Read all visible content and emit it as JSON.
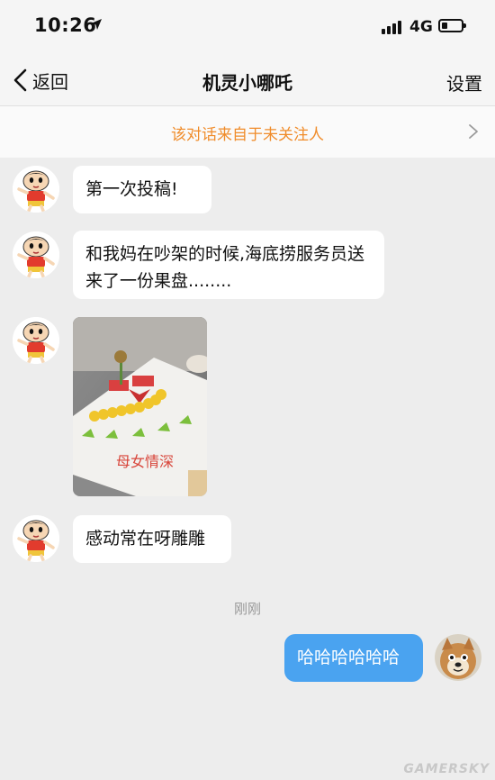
{
  "status_bar": {
    "time": "10:26",
    "network": "4G"
  },
  "nav": {
    "back_label": "返回",
    "title": "机灵小哪吒",
    "settings_label": "设置"
  },
  "notice": {
    "text": "该对话来自于未关注人"
  },
  "messages": [
    {
      "direction": "incoming",
      "type": "text",
      "text": "第一次投稿!"
    },
    {
      "direction": "incoming",
      "type": "text",
      "text": "和我妈在吵架的时候,海底捞服务员送来了一份果盘........"
    },
    {
      "direction": "incoming",
      "type": "image",
      "caption": "母女情深"
    },
    {
      "direction": "incoming",
      "type": "text",
      "text": "感动常在呀雕雕"
    },
    {
      "direction": "outgoing",
      "type": "text",
      "text": "哈哈哈哈哈哈"
    }
  ],
  "timestamp": "刚刚",
  "watermark": "GAMERSKY",
  "colors": {
    "accent_notice": "#f08c2a",
    "outgoing_bubble": "#4aa3f0",
    "background": "#ededed"
  }
}
